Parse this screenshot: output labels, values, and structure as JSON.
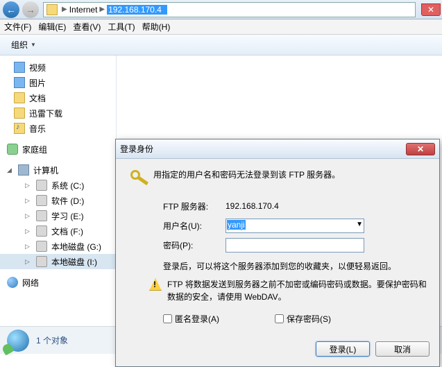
{
  "titlebar": {
    "crumb1": "Internet",
    "crumb2": "192.168.170.4"
  },
  "menu": {
    "file": "文件(F)",
    "edit": "编辑(E)",
    "view": "查看(V)",
    "tools": "工具(T)",
    "help": "帮助(H)"
  },
  "toolbar": {
    "organize": "组织"
  },
  "sidebar": {
    "video": "视频",
    "pictures": "图片",
    "documents": "文档",
    "xunlei": "迅雷下载",
    "music": "音乐",
    "homegroup": "家庭组",
    "computer": "计算机",
    "drive_c": "系统 (C:)",
    "drive_d": "软件 (D:)",
    "drive_e": "学习 (E:)",
    "drive_f": "文档 (F:)",
    "drive_g": "本地磁盘 (G:)",
    "drive_i": "本地磁盘 (I:)",
    "network": "网络"
  },
  "status": {
    "count": "1 个对象"
  },
  "dialog": {
    "title": "登录身份",
    "message": "用指定的用户名和密码无法登录到该 FTP 服务器。",
    "server_label": "FTP 服务器:",
    "server_value": "192.168.170.4",
    "user_label": "用户名(U):",
    "user_value": "yanji",
    "pass_label": "密码(P):",
    "pass_value": "",
    "note": "登录后，可以将这个服务器添加到您的收藏夹，以便轻易返回。",
    "warning": "FTP 将数据发送到服务器之前不加密或编码密码或数据。要保护密码和数据的安全，请使用 WebDAV。",
    "anon": "匿名登录(A)",
    "save": "保存密码(S)",
    "login": "登录(L)",
    "cancel": "取消"
  }
}
